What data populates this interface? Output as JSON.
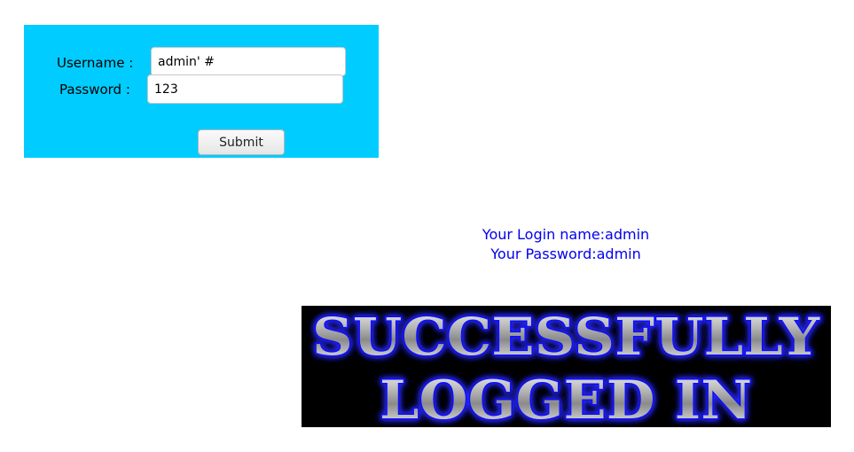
{
  "login_form": {
    "username_label": "Username :",
    "password_label": "Password :",
    "username_value": "admin' #",
    "password_value": "123",
    "submit_label": "Submit",
    "panel_color": "#00ccff"
  },
  "result": {
    "login_name_line": "Your Login name:admin",
    "password_line": "Your Password:admin",
    "text_color": "#0000ee"
  },
  "banner": {
    "line1": "SUCCESSFULLY",
    "line2": "LOGGED IN",
    "glow_color": "#1a1aff",
    "background": "#000000"
  }
}
